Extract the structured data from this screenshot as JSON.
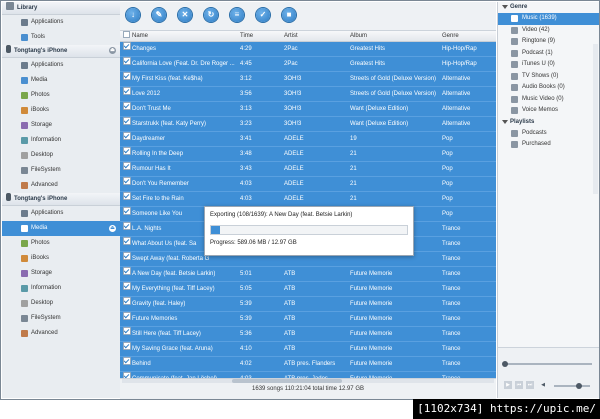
{
  "sidebar": {
    "library": {
      "title": "Library",
      "items": [
        "Applications",
        "Tools"
      ]
    },
    "device1": {
      "title": "Tongtang's iPhone",
      "items": [
        "Applications",
        "Media",
        "Photos",
        "iBooks",
        "Storage",
        "Information",
        "Desktop",
        "FileSystem",
        "Advanced"
      ]
    },
    "device2": {
      "title": "Tongtang's iPhone",
      "items": [
        "Applications",
        "Media",
        "Photos",
        "iBooks",
        "Storage",
        "Information",
        "Desktop",
        "FileSystem",
        "Advanced"
      ],
      "selected": "Media"
    }
  },
  "toolbar": {
    "icons": [
      "import-icon",
      "export-icon",
      "delete-icon",
      "refresh-icon",
      "list-icon",
      "checkmark-icon",
      "stop-icon"
    ]
  },
  "table": {
    "columns": [
      "Name",
      "Time",
      "Artist",
      "Album",
      "Genre"
    ],
    "rows": [
      [
        "Changes",
        "4:29",
        "2Pac",
        "Greatest Hits",
        "Hip-Hop/Rap"
      ],
      [
        "California Love (Feat. Dr. Dre Roger ...",
        "4:45",
        "2Pac",
        "Greatest Hits",
        "Hip-Hop/Rap"
      ],
      [
        "My First Kiss (feat. Ke$ha)",
        "3:12",
        "3OH!3",
        "Streets of Gold (Deluxe Version)",
        "Alternative"
      ],
      [
        "Love 2012",
        "3:56",
        "3OH!3",
        "Streets of Gold (Deluxe Version)",
        "Alternative"
      ],
      [
        "Don't Trust Me",
        "3:13",
        "3OH!3",
        "Want (Deluxe Edition)",
        "Alternative"
      ],
      [
        "Starstrukk (feat. Katy Perry)",
        "3:23",
        "3OH!3",
        "Want (Deluxe Edition)",
        "Alternative"
      ],
      [
        "Daydreamer",
        "3:41",
        "ADELE",
        "19",
        "Pop"
      ],
      [
        "Rolling In the Deep",
        "3:48",
        "ADELE",
        "21",
        "Pop"
      ],
      [
        "Rumour Has It",
        "3:43",
        "ADELE",
        "21",
        "Pop"
      ],
      [
        "Don't You Remember",
        "4:03",
        "ADELE",
        "21",
        "Pop"
      ],
      [
        "Set Fire to the Rain",
        "4:03",
        "ADELE",
        "21",
        "Pop"
      ],
      [
        "Someone Like You",
        "",
        "",
        "",
        "Pop"
      ],
      [
        "L.A. Nights",
        "",
        "",
        "",
        "Trance"
      ],
      [
        "What About Us (feat. Sa",
        "",
        "",
        "",
        "Trance"
      ],
      [
        "Swept Away (feat. Roberta G",
        "",
        "",
        "",
        "Trance"
      ],
      [
        "A New Day (feat. Betsie Larkin)",
        "5:01",
        "ATB",
        "Future Memorie",
        "Trance"
      ],
      [
        "My Everything (feat. Tiff Lacey)",
        "5:05",
        "ATB",
        "Future Memorie",
        "Trance"
      ],
      [
        "Gravity (feat. Haley)",
        "5:39",
        "ATB",
        "Future Memorie",
        "Trance"
      ],
      [
        "Future Memories",
        "5:39",
        "ATB",
        "Future Memorie",
        "Trance"
      ],
      [
        "Still Here (feat. Tiff Lacey)",
        "5:36",
        "ATB",
        "Future Memorie",
        "Trance"
      ],
      [
        "My Saving Grace (feat. Aruna)",
        "4:10",
        "ATB",
        "Future Memorie",
        "Trance"
      ],
      [
        "Behind",
        "4:02",
        "ATB pres. Flanders",
        "Future Memorie",
        "Trance"
      ],
      [
        "Communicate (feat. Jan Löchel)",
        "4:03",
        "ATB pres. Jades",
        "Future Memorie",
        "Trance"
      ],
      [
        "Whataya Want from Me",
        "4:05",
        "Adam Lambert",
        "For Your Entertainment",
        "Pop"
      ]
    ]
  },
  "status": {
    "text": "1639  songs  110:21:04 total time  12.97 GB"
  },
  "right_panel": {
    "genre_title": "Genre",
    "genre_items": [
      {
        "label": "Music (1639)",
        "icon": "music-icon",
        "selected": true
      },
      {
        "label": "Video (42)",
        "icon": "video-icon"
      },
      {
        "label": "Ringtone (9)",
        "icon": "ringtone-icon"
      },
      {
        "label": "Podcast (1)",
        "icon": "podcast-icon"
      },
      {
        "label": "iTunes U (0)",
        "icon": "itunes-u-icon"
      },
      {
        "label": "TV Shows (0)",
        "icon": "tv-icon"
      },
      {
        "label": "Audio Books (0)",
        "icon": "audiobook-icon"
      },
      {
        "label": "Music Video (0)",
        "icon": "music-video-icon"
      },
      {
        "label": "Voice Memos",
        "icon": "voice-memo-icon"
      }
    ],
    "playlists_title": "Playlists",
    "playlist_items": [
      {
        "label": "Podcasts",
        "icon": "playlist-icon"
      },
      {
        "label": "Purchased",
        "icon": "playlist-icon"
      }
    ]
  },
  "export_dialog": {
    "title": "Exporting (108/1639): A New Day (feat. Betsie Larkin)",
    "progress_text": "Progress: 589.06 MB / 12.97 GB",
    "progress": 0.044
  },
  "colors": {
    "accent": "#3f8fd6",
    "sidebar_bg": "#e9edf1"
  },
  "watermark": "[1102x734] https://upic.me/"
}
